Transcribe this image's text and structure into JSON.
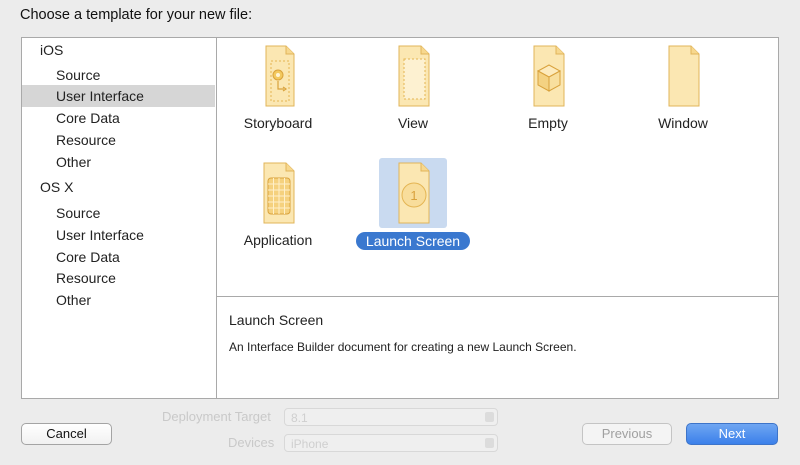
{
  "dialog": {
    "prompt": "Choose a template for your new file:"
  },
  "sidebar": {
    "groups": [
      {
        "label": "iOS",
        "items": [
          "Source",
          "User Interface",
          "Core Data",
          "Resource",
          "Other"
        ]
      },
      {
        "label": "OS X",
        "items": [
          "Source",
          "User Interface",
          "Core Data",
          "Resource",
          "Other"
        ]
      }
    ],
    "selected_group": "iOS",
    "selected_item": "User Interface"
  },
  "templates": [
    {
      "name": "Storyboard",
      "icon": "storyboard-document-icon"
    },
    {
      "name": "View",
      "icon": "view-document-icon"
    },
    {
      "name": "Empty",
      "icon": "empty-cube-document-icon"
    },
    {
      "name": "Window",
      "icon": "window-document-icon"
    },
    {
      "name": "Application",
      "icon": "application-grid-document-icon"
    },
    {
      "name": "Launch Screen",
      "icon": "launch-screen-document-icon"
    }
  ],
  "selected_template": "Launch Screen",
  "description": {
    "title": "Launch Screen",
    "text": "An Interface Builder document for creating a new Launch Screen."
  },
  "buttons": {
    "cancel": "Cancel",
    "previous": "Previous",
    "next": "Next"
  },
  "background": {
    "deployment_label": "Deployment Target",
    "deployment_value": "8.1",
    "devices_label": "Devices",
    "devices_value": "iPhone"
  },
  "colors": {
    "accent": "#3a78cf",
    "selection_bg": "#d6d6d6",
    "icon_fill": "#fbe7b2",
    "icon_stroke": "#e7b95a"
  }
}
